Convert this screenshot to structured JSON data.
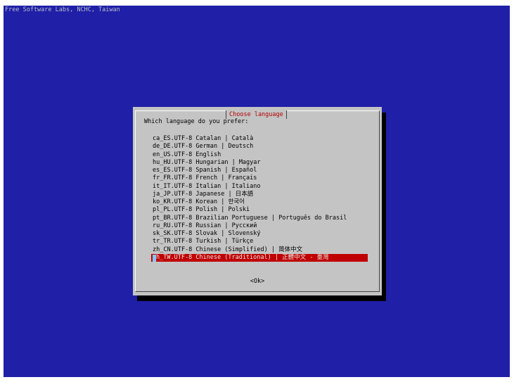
{
  "banner": "Free Software Labs, NCHC, Taiwan",
  "dialog": {
    "title": "Choose language",
    "question": "Which language do you prefer:",
    "ok_label": "<Ok>"
  },
  "languages": [
    "ca_ES.UTF-8 Catalan | Català",
    "de_DE.UTF-8 German | Deutsch",
    "en_US.UTF-8 English",
    "hu_HU.UTF-8 Hungarian | Magyar",
    "es_ES.UTF-8 Spanish | Español",
    "fr_FR.UTF-8 French | Français",
    "it_IT.UTF-8 Italian | Italiano",
    "ja_JP.UTF-8 Japanese | 日本語",
    "ko_KR.UTF-8 Korean | 한국어",
    "pl_PL.UTF-8 Polish | Polski",
    "pt_BR.UTF-8 Brazilian Portuguese | Português do Brasil",
    "ru_RU.UTF-8 Russian | Русский",
    "sk_SK.UTF-8 Slovak | Slovenský",
    "tr_TR.UTF-8 Turkish | Türkçe",
    "zh_CN.UTF-8 Chinese (Simplified) | 简体中文"
  ],
  "selected_language": "h_TW.UTF-8 Chinese (Traditional) | 正體中文 - 臺灣",
  "colors": {
    "background": "#1f1fa8",
    "dialog": "#c4c4c4",
    "title": "#b00000",
    "selection": "#c00000"
  }
}
